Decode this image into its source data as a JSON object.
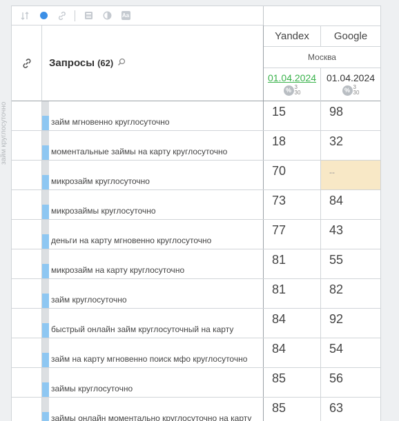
{
  "side_label": "займ круглосуточно",
  "toolbar": {
    "icons": [
      "sort-icon",
      "circle-icon",
      "link-icon",
      "calculator-icon",
      "contrast-icon",
      "font-icon"
    ],
    "font_icon_text": "Aa"
  },
  "header": {
    "queries_title": "Запросы",
    "queries_count": "(62)",
    "engines": [
      "Yandex",
      "Google"
    ],
    "region": "Москва",
    "dates": [
      "01.04.2024",
      "01.04.2024"
    ],
    "pct_top": "3",
    "pct_bottom": "30"
  },
  "rows": [
    {
      "query": "займ мгновенно круглосуточно",
      "yandex": "15",
      "google": "98"
    },
    {
      "query": "моментальные займы на карту круглосуточно",
      "yandex": "18",
      "google": "32"
    },
    {
      "query": "микрозайм круглосуточно",
      "yandex": "70",
      "google": "--"
    },
    {
      "query": "микрозаймы круглосуточно",
      "yandex": "73",
      "google": "84"
    },
    {
      "query": "деньги на карту мгновенно круглосуточно",
      "yandex": "77",
      "google": "43"
    },
    {
      "query": "микрозайм на карту круглосуточно",
      "yandex": "81",
      "google": "55"
    },
    {
      "query": "займ круглосуточно",
      "yandex": "81",
      "google": "82"
    },
    {
      "query": "быстрый онлайн займ круглосуточный на карту",
      "yandex": "84",
      "google": "92"
    },
    {
      "query": "займ на карту мгновенно поиск мфо круглосуточно",
      "yandex": "84",
      "google": "54"
    },
    {
      "query": "займы круглосуточно",
      "yandex": "85",
      "google": "56"
    },
    {
      "query": "займы онлайн моментально круглосуточно на карту",
      "yandex": "85",
      "google": "63"
    }
  ],
  "colors": {
    "accent_green": "#38b24a",
    "dot_blue": "#3b8fe6",
    "empty_cell": "#f8e8c6",
    "bar_blue": "#8ec7f2"
  }
}
